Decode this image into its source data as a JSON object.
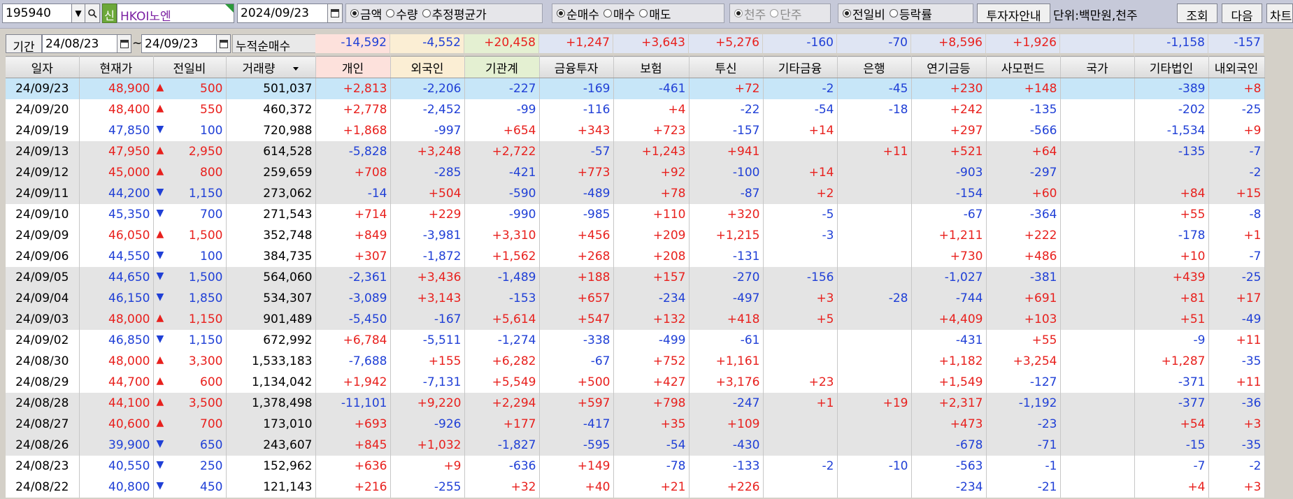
{
  "toolbar": {
    "code": "195940",
    "badge": "신",
    "name": "HKOI노엔",
    "date": "2024/09/23",
    "group1": [
      "금액",
      "수량",
      "추정평균가"
    ],
    "group2": [
      "순매수",
      "매수",
      "매도"
    ],
    "group3": [
      "천주",
      "단주"
    ],
    "group4": [
      "전일비",
      "등락률"
    ],
    "guide": "투자자안내",
    "unit": "단위:백만원,천주",
    "query": "조회",
    "next": "다음",
    "chart": "차트"
  },
  "range": {
    "label": "기간",
    "from": "24/08/23",
    "sep": "~",
    "to": "24/09/23",
    "cum_label": "누적순매수",
    "sums": [
      "-14,592",
      "-4,552",
      "+20,458",
      "+1,247",
      "+3,643",
      "+5,276",
      "-160",
      "-70",
      "+8,596",
      "+1,926",
      "",
      "-1,158",
      "-157"
    ]
  },
  "colors": {
    "up": "#e8201d",
    "down": "#1f3fd6",
    "selected_row": "#c7e6f8",
    "individual_bg": "#fde1dc",
    "foreign_bg": "#fbeed4",
    "institution_bg": "#e4f0d2",
    "other_bg": "#dfe5f3"
  },
  "columns": [
    "일자",
    "현재가",
    "전일비",
    "거래량",
    "개인",
    "외국인",
    "기관계",
    "금융투자",
    "보험",
    "투신",
    "기타금융",
    "은행",
    "연기금등",
    "사모펀드",
    "국가",
    "기타법인",
    "내외국인"
  ],
  "rows": [
    {
      "d": "24/09/23",
      "p": "48,900",
      "dir": "up",
      "c": "500",
      "v": "501,037",
      "f": [
        "+2,813",
        "-2,206",
        "-227",
        "-169",
        "-461",
        "+72",
        "-2",
        "-45",
        "+230",
        "+148",
        "",
        "-389",
        "+8"
      ]
    },
    {
      "d": "24/09/20",
      "p": "48,400",
      "dir": "up",
      "c": "550",
      "v": "460,372",
      "f": [
        "+2,778",
        "-2,452",
        "-99",
        "-116",
        "+4",
        "-22",
        "-54",
        "-18",
        "+242",
        "-135",
        "",
        "-202",
        "-25"
      ]
    },
    {
      "d": "24/09/19",
      "p": "47,850",
      "dir": "down",
      "c": "100",
      "v": "720,988",
      "f": [
        "+1,868",
        "-997",
        "+654",
        "+343",
        "+723",
        "-157",
        "+14",
        "",
        "+297",
        "-566",
        "",
        "-1,534",
        "+9"
      ]
    },
    {
      "d": "24/09/13",
      "p": "47,950",
      "dir": "up",
      "c": "2,950",
      "v": "614,528",
      "f": [
        "-5,828",
        "+3,248",
        "+2,722",
        "-57",
        "+1,243",
        "+941",
        "",
        "+11",
        "+521",
        "+64",
        "",
        "-135",
        "-7"
      ]
    },
    {
      "d": "24/09/12",
      "p": "45,000",
      "dir": "up",
      "c": "800",
      "v": "259,659",
      "f": [
        "+708",
        "-285",
        "-421",
        "+773",
        "+92",
        "-100",
        "+14",
        "",
        "-903",
        "-297",
        "",
        "",
        "-2"
      ]
    },
    {
      "d": "24/09/11",
      "p": "44,200",
      "dir": "down",
      "c": "1,150",
      "v": "273,062",
      "f": [
        "-14",
        "+504",
        "-590",
        "-489",
        "+78",
        "-87",
        "+2",
        "",
        "-154",
        "+60",
        "",
        "+84",
        "+15"
      ]
    },
    {
      "d": "24/09/10",
      "p": "45,350",
      "dir": "down",
      "c": "700",
      "v": "271,543",
      "f": [
        "+714",
        "+229",
        "-990",
        "-985",
        "+110",
        "+320",
        "-5",
        "",
        "-67",
        "-364",
        "",
        "+55",
        "-8"
      ]
    },
    {
      "d": "24/09/09",
      "p": "46,050",
      "dir": "up",
      "c": "1,500",
      "v": "352,748",
      "f": [
        "+849",
        "-3,981",
        "+3,310",
        "+456",
        "+209",
        "+1,215",
        "-3",
        "",
        "+1,211",
        "+222",
        "",
        "-178",
        "+1"
      ]
    },
    {
      "d": "24/09/06",
      "p": "44,550",
      "dir": "down",
      "c": "100",
      "v": "384,735",
      "f": [
        "+307",
        "-1,872",
        "+1,562",
        "+268",
        "+208",
        "-131",
        "",
        "",
        "+730",
        "+486",
        "",
        "+10",
        "-7"
      ]
    },
    {
      "d": "24/09/05",
      "p": "44,650",
      "dir": "down",
      "c": "1,500",
      "v": "564,060",
      "f": [
        "-2,361",
        "+3,436",
        "-1,489",
        "+188",
        "+157",
        "-270",
        "-156",
        "",
        "-1,027",
        "-381",
        "",
        "+439",
        "-25"
      ]
    },
    {
      "d": "24/09/04",
      "p": "46,150",
      "dir": "down",
      "c": "1,850",
      "v": "534,307",
      "f": [
        "-3,089",
        "+3,143",
        "-153",
        "+657",
        "-234",
        "-497",
        "+3",
        "-28",
        "-744",
        "+691",
        "",
        "+81",
        "+17"
      ]
    },
    {
      "d": "24/09/03",
      "p": "48,000",
      "dir": "up",
      "c": "1,150",
      "v": "901,489",
      "f": [
        "-5,450",
        "-167",
        "+5,614",
        "+547",
        "+132",
        "+418",
        "+5",
        "",
        "+4,409",
        "+103",
        "",
        "+51",
        "-49"
      ]
    },
    {
      "d": "24/09/02",
      "p": "46,850",
      "dir": "down",
      "c": "1,150",
      "v": "672,992",
      "f": [
        "+6,784",
        "-5,511",
        "-1,274",
        "-338",
        "-499",
        "-61",
        "",
        "",
        "-431",
        "+55",
        "",
        "-9",
        "+11"
      ]
    },
    {
      "d": "24/08/30",
      "p": "48,000",
      "dir": "up",
      "c": "3,300",
      "v": "1,533,183",
      "f": [
        "-7,688",
        "+155",
        "+6,282",
        "-67",
        "+752",
        "+1,161",
        "",
        "",
        "+1,182",
        "+3,254",
        "",
        "+1,287",
        "-35"
      ]
    },
    {
      "d": "24/08/29",
      "p": "44,700",
      "dir": "up",
      "c": "600",
      "v": "1,134,042",
      "f": [
        "+1,942",
        "-7,131",
        "+5,549",
        "+500",
        "+427",
        "+3,176",
        "+23",
        "",
        "+1,549",
        "-127",
        "",
        "-371",
        "+11"
      ]
    },
    {
      "d": "24/08/28",
      "p": "44,100",
      "dir": "up",
      "c": "3,500",
      "v": "1,378,498",
      "f": [
        "-11,101",
        "+9,220",
        "+2,294",
        "+597",
        "+798",
        "-247",
        "+1",
        "+19",
        "+2,317",
        "-1,192",
        "",
        "-377",
        "-36"
      ]
    },
    {
      "d": "24/08/27",
      "p": "40,600",
      "dir": "up",
      "c": "700",
      "v": "173,010",
      "f": [
        "+693",
        "-926",
        "+177",
        "-417",
        "+35",
        "+109",
        "",
        "",
        "+473",
        "-23",
        "",
        "+54",
        "+3"
      ]
    },
    {
      "d": "24/08/26",
      "p": "39,900",
      "dir": "down",
      "c": "650",
      "v": "243,607",
      "f": [
        "+845",
        "+1,032",
        "-1,827",
        "-595",
        "-54",
        "-430",
        "",
        "",
        "-678",
        "-71",
        "",
        "-15",
        "-35"
      ]
    },
    {
      "d": "24/08/23",
      "p": "40,550",
      "dir": "down",
      "c": "250",
      "v": "152,962",
      "f": [
        "+636",
        "+9",
        "-636",
        "+149",
        "-78",
        "-133",
        "-2",
        "-10",
        "-563",
        "-1",
        "",
        "-7",
        "-2"
      ]
    },
    {
      "d": "24/08/22",
      "p": "40,800",
      "dir": "down",
      "c": "450",
      "v": "121,143",
      "f": [
        "+216",
        "-255",
        "+32",
        "+40",
        "+21",
        "+226",
        "",
        "",
        "-234",
        "-21",
        "",
        "+4",
        "+3"
      ]
    }
  ],
  "row_shading": [
    "sel",
    "w",
    "w",
    "g",
    "g",
    "g",
    "w",
    "w",
    "w",
    "g",
    "g",
    "g",
    "w",
    "w",
    "w",
    "g",
    "g",
    "g",
    "w",
    "w"
  ]
}
